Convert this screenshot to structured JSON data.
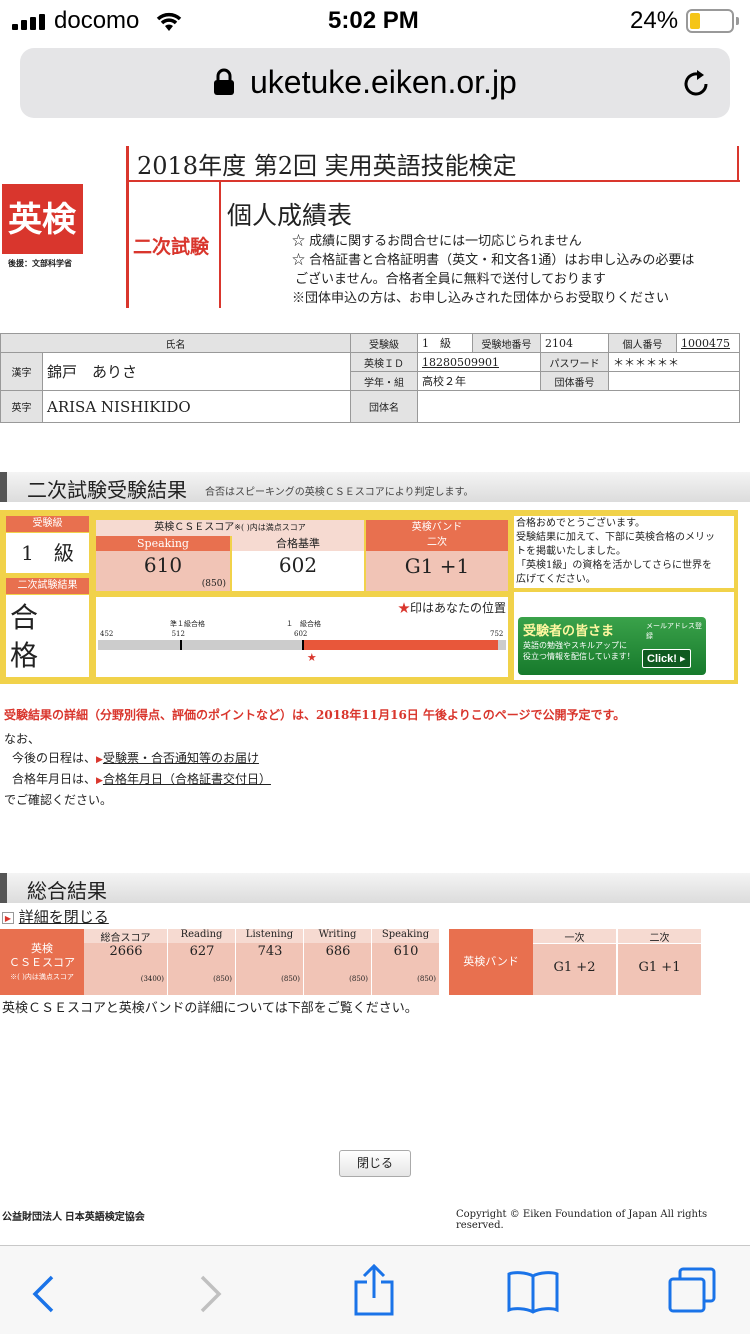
{
  "status": {
    "carrier": "docomo",
    "time": "5:02 PM",
    "battery": "24%"
  },
  "browser": {
    "url": "uketuke.eiken.or.jp"
  },
  "header": {
    "logo": "英検",
    "logo_sub": "後援：文部科学省",
    "title": "2018年度 第2回 実用英語技能検定",
    "exam_type": "二次試験",
    "doc_title": "個人成績表",
    "notes": [
      "☆ 成績に関するお問合せには一切応じられません",
      "☆ 合格証書と合格証明書（英文・和文各1通）はお申し込みの必要は",
      "ございません。合格者全員に無料で送付しております",
      "※団体申込の方は、お申し込みされた団体からお受取りください"
    ]
  },
  "info": {
    "name_label": "氏名",
    "kanji_label": "漢字",
    "kanji": "錦戸　ありさ",
    "eiji_label": "英字",
    "eiji": "ARISA NISHIKIDO",
    "grade_label": "受験級",
    "grade": "1　級",
    "area_label": "受験地番号",
    "area": "2104",
    "personal_label": "個人番号",
    "personal": "1000475",
    "id_label": "英検ＩＤ",
    "id": "18280509901",
    "pw_label": "パスワード",
    "pw": "＊＊＊＊＊＊",
    "school_label": "学年・組",
    "school": "高校２年",
    "group_no_label": "団体番号",
    "group_label": "団体名"
  },
  "second": {
    "section_title": "二次試験受験結果",
    "section_note": "合否はスピーキングの英検ＣＳＥスコアにより判定します。",
    "grade_label": "受験級",
    "grade": "1　級",
    "result_label": "二次試験結果",
    "result": "合格",
    "cse_label": "英検ＣＳＥスコア",
    "cse_note": "※( )内は満点スコア",
    "speaking_label": "Speaking",
    "speaking": "610",
    "speaking_max": "(850)",
    "pass_label": "合格基準",
    "pass": "602",
    "band_label": "英検バンド",
    "band_sub": "二次",
    "band": "G1 +1",
    "marker_note": "印はあなたの位置",
    "scale_labels": [
      "452",
      "512",
      "602",
      "752"
    ],
    "marker_label_1": "準１級合格",
    "marker_label_2": "１　級合格",
    "message": [
      "合格おめでとうございます。",
      "受験結果に加えて、下部に英検合格のメリッ",
      "トを掲載いたしました。",
      "「英検1級」の資格を活かしてさらに世界を",
      "広げてください。"
    ],
    "banner_title": "受験者の皆さま",
    "banner_tag": "メールアドレス登録",
    "banner_body": [
      "英語の勉強やスキルアップに",
      "役立つ情報を配信しています！"
    ],
    "banner_click": "Click! ▸",
    "chart_data": {
      "type": "bar",
      "values": [
        610
      ],
      "xlim": [
        452,
        752
      ],
      "markers": [
        512,
        602
      ],
      "xlabel": "",
      "ylabel": "",
      "title": ""
    }
  },
  "detail": {
    "red_notice": "受験結果の詳細（分野別得点、評価のポイントなど）は、2018年11月16日 午後よりこのページで公開予定です。",
    "line1": "なお、",
    "line2_pre": "今後の日程は、",
    "link1": "受験票・合否通知等のお届け",
    "line3_pre": "合格年月日は、",
    "link2": "合格年月日（合格証書交付日）",
    "line4": "でご確認ください。"
  },
  "overall": {
    "section_title": "総合結果",
    "close_detail": "詳細を閉じる",
    "cse_label_1": "英検",
    "cse_label_2": "ＣＳＥスコア",
    "cse_note": "※( )内は満点スコア",
    "columns": [
      {
        "label": "総合スコア",
        "score": "2666",
        "max": "(3400)"
      },
      {
        "label": "Reading",
        "score": "627",
        "max": "(850)"
      },
      {
        "label": "Listening",
        "score": "743",
        "max": "(850)"
      },
      {
        "label": "Writing",
        "score": "686",
        "max": "(850)"
      },
      {
        "label": "Speaking",
        "score": "610",
        "max": "(850)"
      }
    ],
    "band_label": "英検バンド",
    "band_first_label": "一次",
    "band_first": "G1 +2",
    "band_second_label": "二次",
    "band_second": "G1 +1",
    "footer_note": "英検ＣＳＥスコアと英検バンドの詳細については下部をご覧ください。"
  },
  "footer": {
    "close_button": "閉じる",
    "org": "公益財団法人 日本英語検定協会",
    "copyright": "Copyright © Eiken Foundation of Japan All rights reserved."
  }
}
